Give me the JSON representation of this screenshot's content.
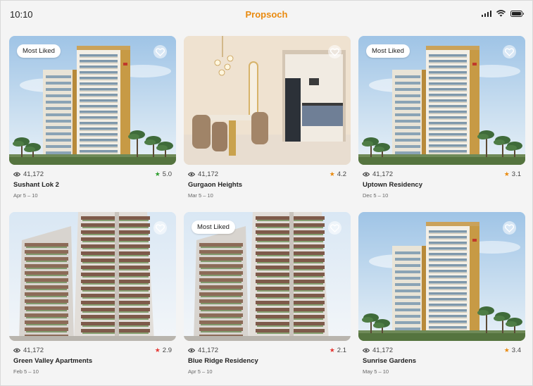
{
  "status_bar": {
    "time": "10:10"
  },
  "app": {
    "title": "Propsoch"
  },
  "listings": [
    {
      "name": "Sushant Lok 2",
      "views": "41,172",
      "rating": "5.0",
      "rating_color": "#2e9e2e",
      "dates": "Apr 5 – 10",
      "badge": "Most Liked",
      "image": "tower-a"
    },
    {
      "name": "Gurgaon Heights",
      "views": "41,172",
      "rating": "4.2",
      "rating_color": "#e98a0f",
      "dates": "Mar 5 – 10",
      "badge": "",
      "image": "interior"
    },
    {
      "name": "Uptown Residency",
      "views": "41,172",
      "rating": "3.1",
      "rating_color": "#e98a0f",
      "dates": "Dec 5 – 10",
      "badge": "Most Liked",
      "image": "tower-a"
    },
    {
      "name": "Green Valley Apartments",
      "views": "41,172",
      "rating": "2.9",
      "rating_color": "#e53935",
      "dates": "Feb 5 – 10",
      "badge": "",
      "image": "tower-b"
    },
    {
      "name": "Blue Ridge Residency",
      "views": "41,172",
      "rating": "2.1",
      "rating_color": "#e53935",
      "dates": "Apr 5 – 10",
      "badge": "Most Liked",
      "image": "tower-b"
    },
    {
      "name": "Sunrise Gardens",
      "views": "41,172",
      "rating": "3.4",
      "rating_color": "#e98a0f",
      "dates": "May 5 – 10",
      "badge": "",
      "image": "tower-a"
    }
  ],
  "icons": {
    "views": "eye-icon",
    "rating": "star-icon",
    "favorite": "heart-icon",
    "signal": "signal-icon",
    "wifi": "wifi-icon",
    "battery": "battery-icon"
  }
}
